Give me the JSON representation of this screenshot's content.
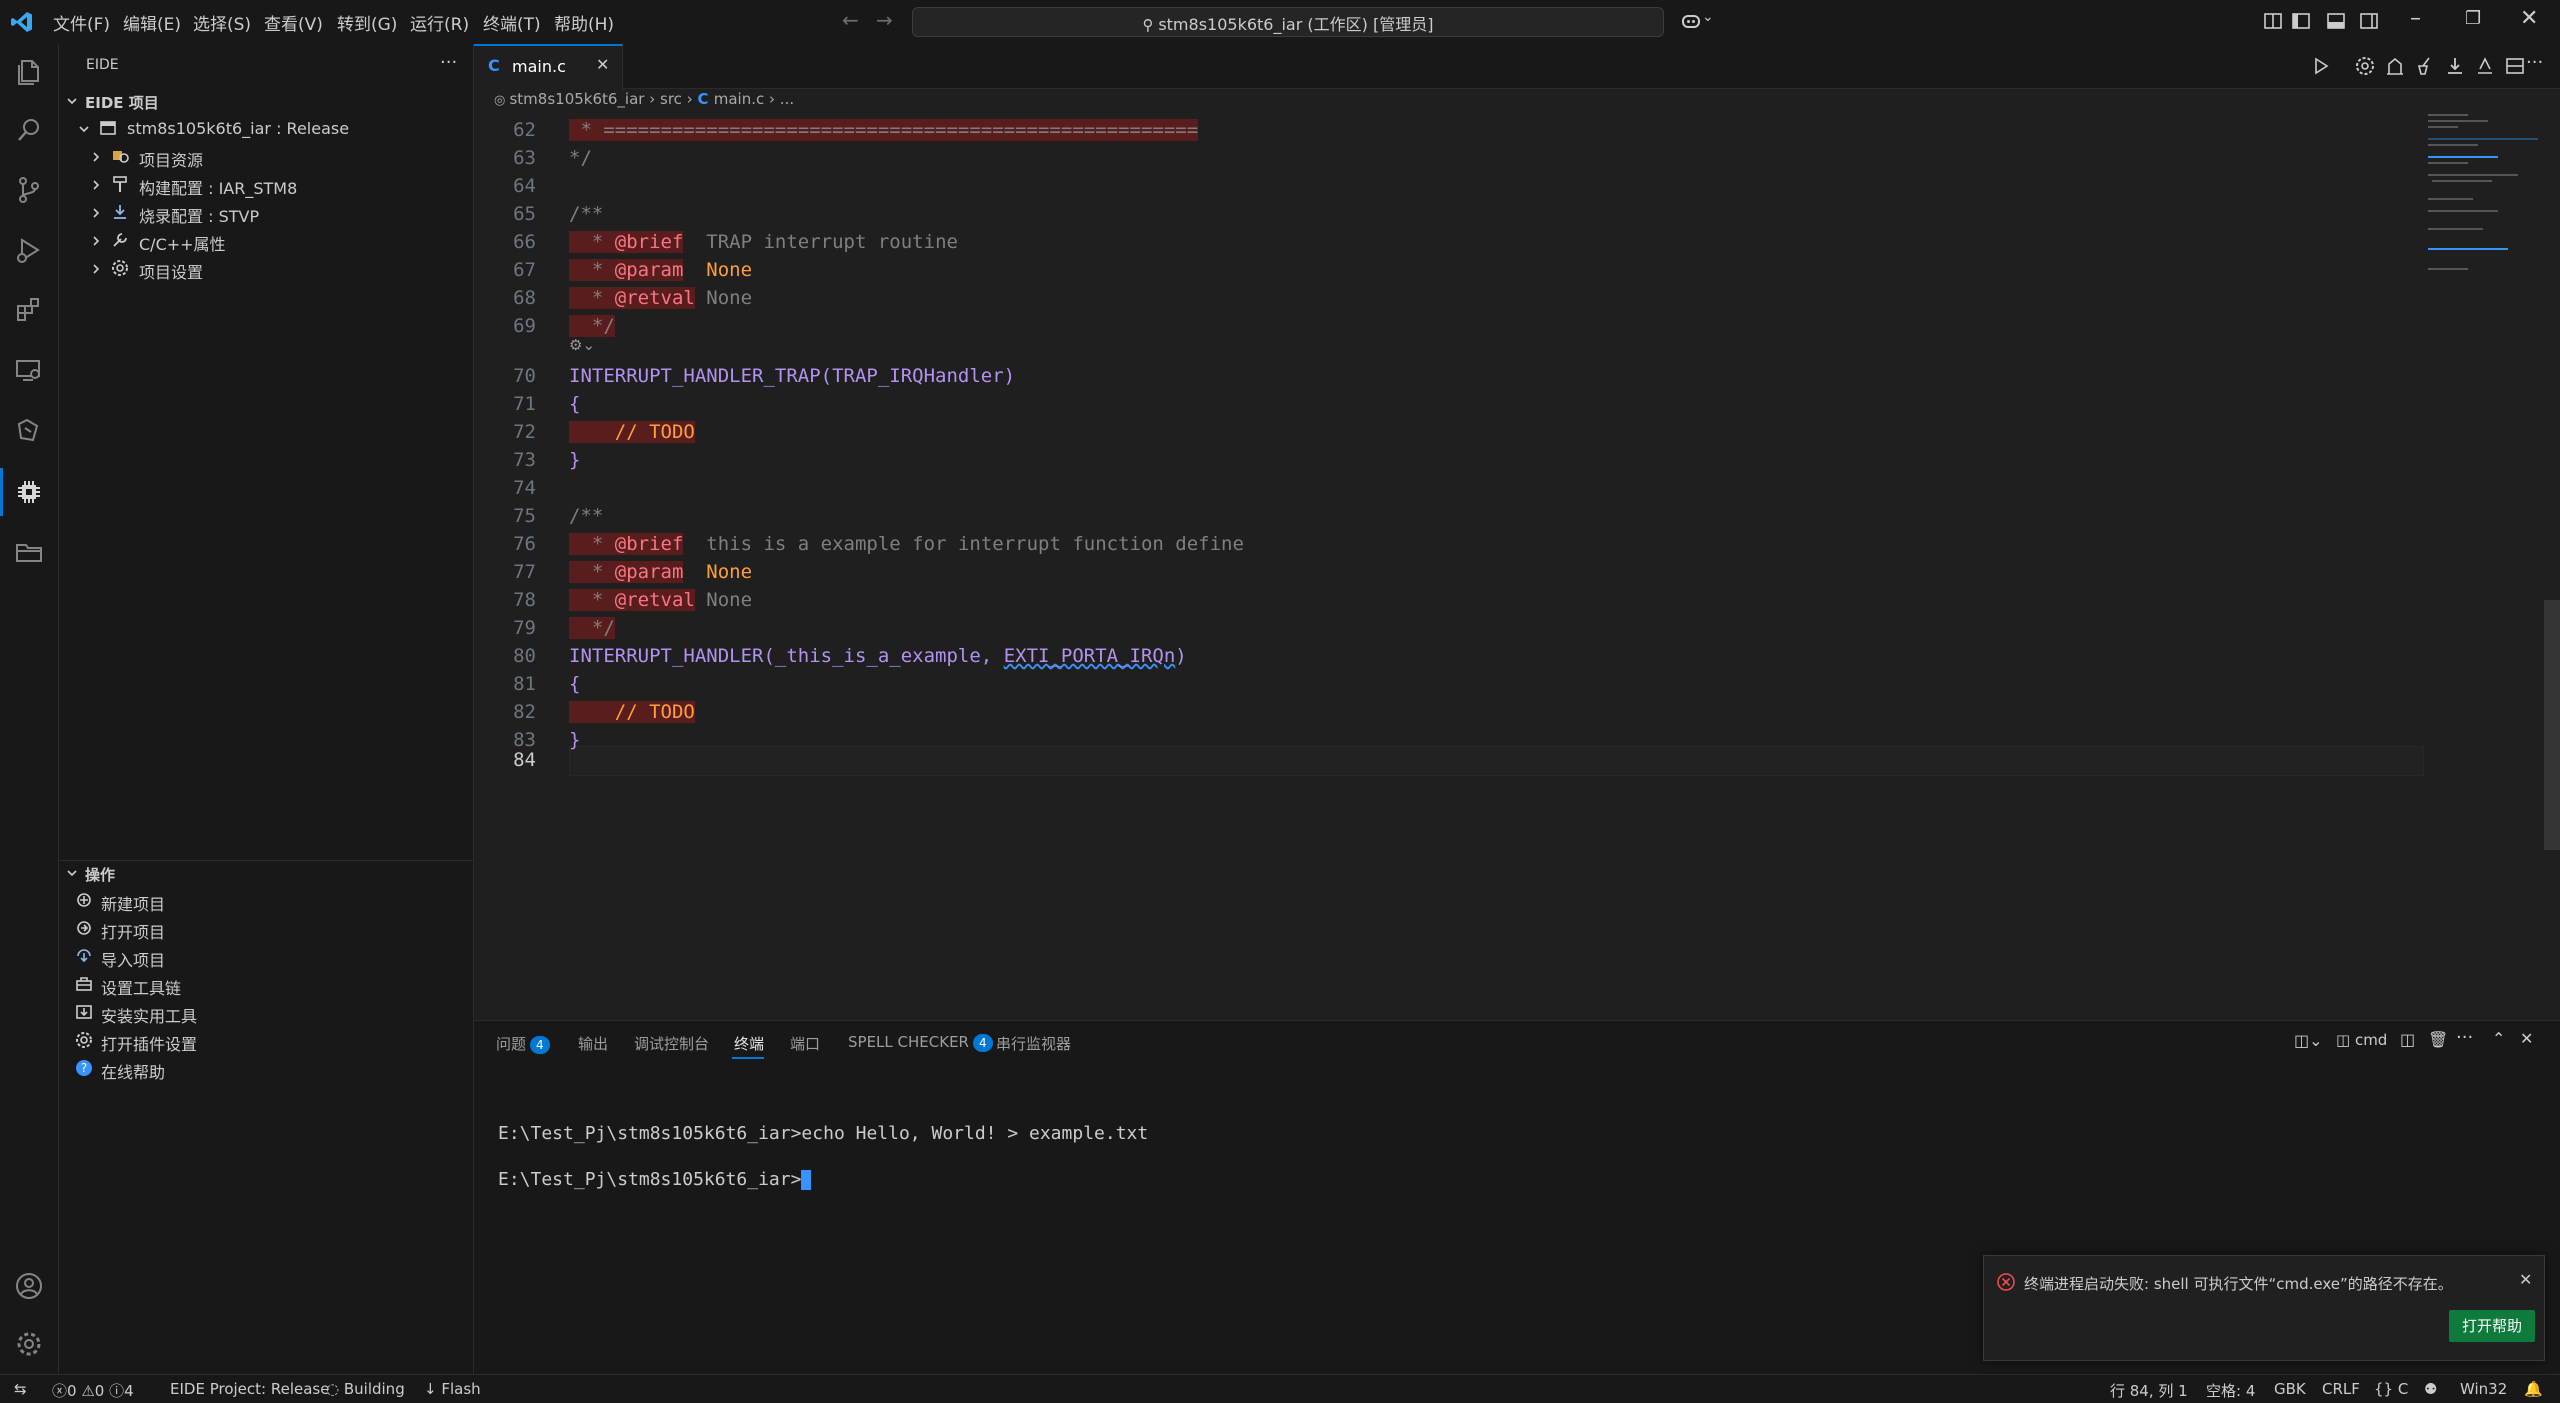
{
  "titlebar": {
    "menus": [
      "文件(F)",
      "编辑(E)",
      "选择(S)",
      "查看(V)",
      "转到(G)",
      "运行(R)",
      "终端(T)",
      "帮助(H)"
    ],
    "search_text": "stm8s105k6t6_iar (工作区) [管理员]"
  },
  "sidebar": {
    "title": "EIDE",
    "project_section": "EIDE 项目",
    "project_name": "stm8s105k6t6_iar : Release",
    "project_items": [
      "项目资源",
      "构建配置 : IAR_STM8",
      "烧录配置 : STVP",
      "C/C++属性",
      "项目设置"
    ],
    "ops_section": "操作",
    "ops_items": [
      "新建项目",
      "打开项目",
      "导入项目",
      "设置工具链",
      "安装实用工具",
      "打开插件设置",
      "在线帮助"
    ]
  },
  "editor": {
    "tab_label": "main.c",
    "breadcrumb": [
      "stm8s105k6t6_iar",
      "src",
      "main.c",
      "..."
    ],
    "line_numbers": [
      "62",
      "63",
      "64",
      "65",
      "66",
      "67",
      "68",
      "69",
      "70",
      "71",
      "72",
      "73",
      "74",
      "75",
      "76",
      "77",
      "78",
      "79",
      "80",
      "81",
      "82",
      "83",
      "84"
    ],
    "code": {
      "l62": " * ====================================================",
      "l63": "*/",
      "l65": "/**",
      "l66a": "  * ",
      "l66b": "@brief",
      "l66c": "  TRAP interrupt routine",
      "l67a": "  * ",
      "l67b": "@param",
      "l67c": "  None",
      "l68a": "  * ",
      "l68b": "@retval",
      "l68c": " None",
      "l69": "  */",
      "l70": "INTERRUPT_HANDLER_TRAP(TRAP_IRQHandler)",
      "l71": "{",
      "l72": "    // TODO",
      "l73": "}",
      "l75": "/**",
      "l76a": "  * ",
      "l76b": "@brief",
      "l76c": "  this is a example for interrupt function define",
      "l77a": "  * ",
      "l77b": "@param",
      "l77c": "  None",
      "l78a": "  * ",
      "l78b": "@retval",
      "l78c": " None",
      "l79": "  */",
      "l80a": "INTERRUPT_HANDLER(_this_is_a_example, ",
      "l80b": "EXTI_PORTA_IRQn",
      "l80c": ")",
      "l81": "{",
      "l82": "    // TODO",
      "l83": "}"
    }
  },
  "panel": {
    "tabs": [
      "问题",
      "输出",
      "调试控制台",
      "终端",
      "端口",
      "SPELL CHECKER",
      "串行监视器"
    ],
    "problems_count": "4",
    "spell_count": "4",
    "shell_label": "cmd",
    "terminal_lines": [
      "E:\\Test_Pj\\stm8s105k6t6_iar>echo Hello, World! > example.txt",
      "E:\\Test_Pj\\stm8s105k6t6_iar>"
    ]
  },
  "notification": {
    "message": "终端进程启动失败: shell 可执行文件“cmd.exe”的路径不存在。",
    "button": "打开帮助"
  },
  "statusbar": {
    "errors": "0",
    "warnings": "0",
    "infos": "4",
    "project": "EIDE Project: Release",
    "building": "Building",
    "flash": "Flash",
    "position": "行 84, 列 1",
    "spaces": "空格: 4",
    "encoding": "GBK",
    "eol": "CRLF",
    "language": "{} C",
    "platform": "Win32"
  },
  "colors": {
    "accent": "#0078d4",
    "error_bg": "#5a1d1d",
    "button_green": "#0e7a3b"
  }
}
